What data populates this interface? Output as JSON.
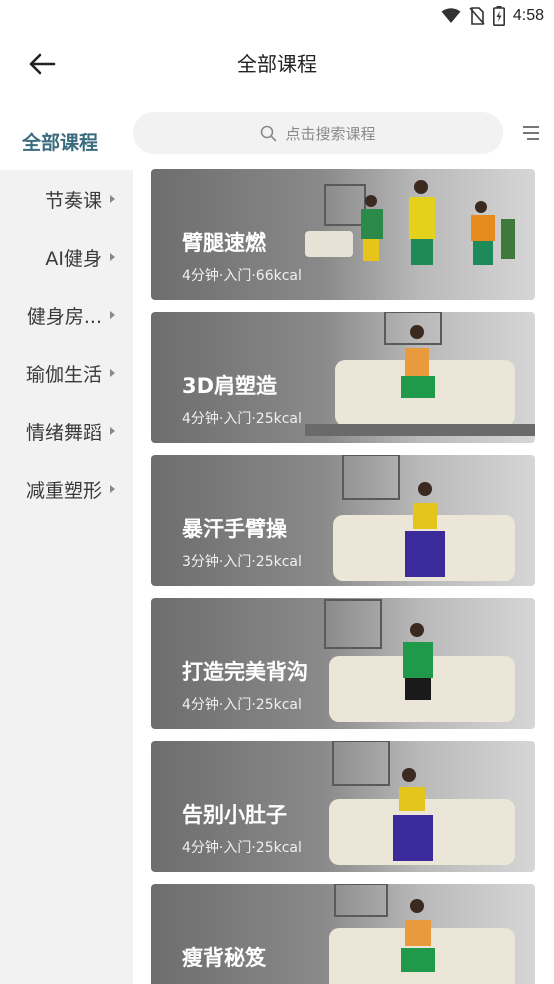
{
  "status_bar": {
    "time": "4:58"
  },
  "header": {
    "title": "全部课程"
  },
  "search": {
    "placeholder": "点击搜索课程"
  },
  "sidebar": {
    "active": "全部课程",
    "items": [
      {
        "label": "节奏课"
      },
      {
        "label": "AI健身"
      },
      {
        "label": "健身房..."
      },
      {
        "label": "瑜伽生活"
      },
      {
        "label": "情绪舞蹈"
      },
      {
        "label": "减重塑形"
      }
    ]
  },
  "courses": [
    {
      "title": "臂腿速燃",
      "meta": "4分钟·入门·66kcal"
    },
    {
      "title": "3D肩塑造",
      "meta": "4分钟·入门·25kcal"
    },
    {
      "title": "暴汗手臂操",
      "meta": "3分钟·入门·25kcal"
    },
    {
      "title": "打造完美背沟",
      "meta": "4分钟·入门·25kcal"
    },
    {
      "title": "告别小肚子",
      "meta": "4分钟·入门·25kcal"
    },
    {
      "title": "瘦背秘笈",
      "meta": ""
    }
  ],
  "colors": {
    "accent": "#3a6b7e",
    "sidebar_bg": "#f2f2f2",
    "search_bg": "#f2f2f2"
  }
}
